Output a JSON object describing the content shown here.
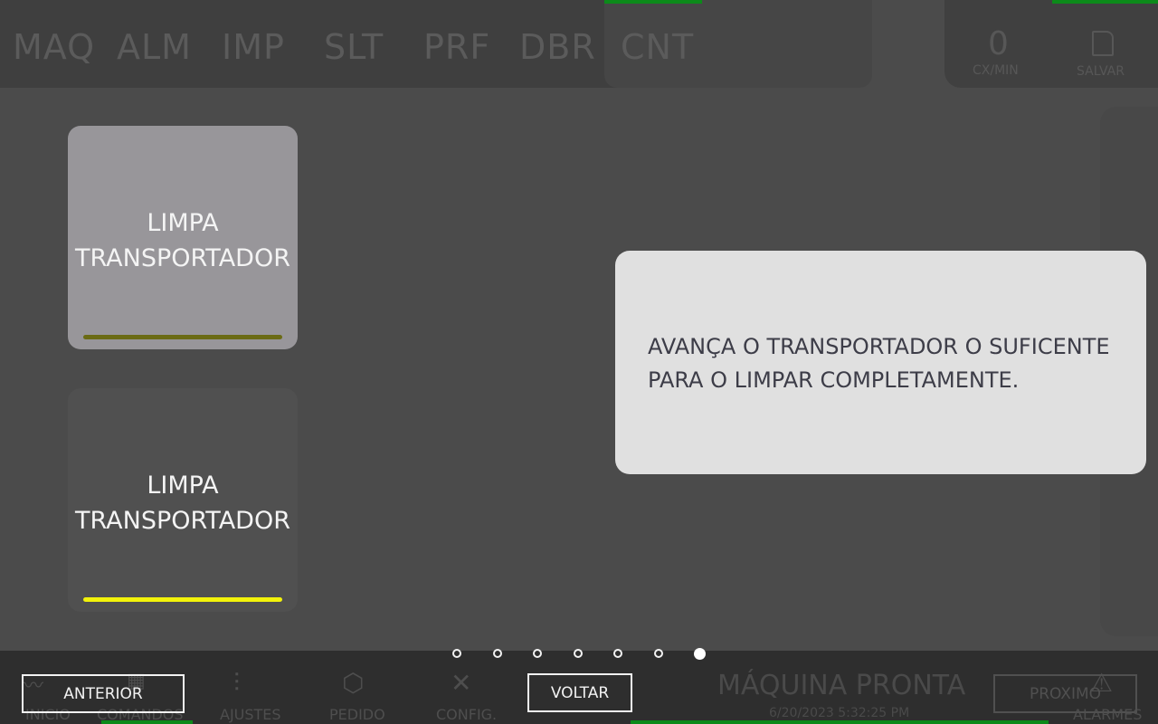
{
  "top_nav": {
    "items": [
      "MAQ",
      "ALM",
      "IMP",
      "SLT",
      "PRF",
      "DBR",
      "CNT"
    ]
  },
  "top_right": {
    "rate_value": "0",
    "rate_label": "CX/MIN",
    "save_label": "SALVAR"
  },
  "cards": [
    {
      "label": "LIMPA TRANSPORTADOR",
      "state": "selected",
      "bar_color": "#6b6b14"
    },
    {
      "label": "LIMPA TRANSPORTADOR",
      "state": "unselected",
      "bar_color": "#f2f20a"
    }
  ],
  "info": {
    "text": "AVANÇA O TRANSPORTADOR O SUFICENTE PARA O LIMPAR COMPLETAMENTE."
  },
  "pager": {
    "total": 7,
    "current": 7
  },
  "bottom_nav": {
    "items": [
      "INICIO",
      "COMANDOS",
      "AJUSTES",
      "PEDIDO",
      "CONFIG.",
      "ALARMES"
    ],
    "status": "MÁQUINA PRONTA",
    "datetime": "6/20/2023 5:32:25 PM"
  },
  "buttons": {
    "previous": "ANTERIOR",
    "back": "VOLTAR",
    "next": "PROXIMO"
  },
  "colors": {
    "accent_green": "#0c8a1a",
    "background": "#4b4b4b",
    "info_box": "#e0e0e0"
  }
}
